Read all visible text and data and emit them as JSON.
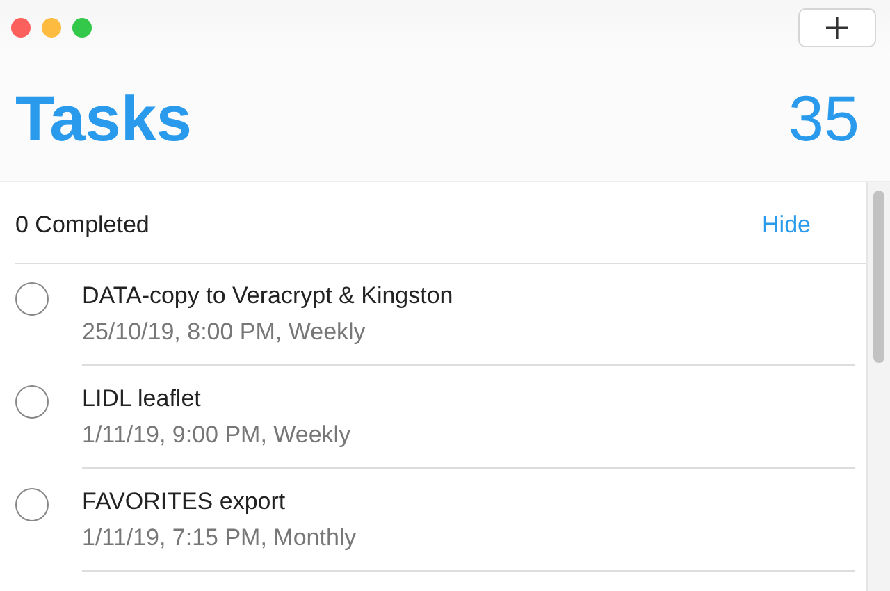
{
  "window": {
    "controls": [
      {
        "color": "#fc605c"
      },
      {
        "color": "#fdbc40"
      },
      {
        "color": "#34c84a"
      }
    ]
  },
  "header": {
    "title": "Tasks",
    "count": "35"
  },
  "completed_bar": {
    "label": "0 Completed",
    "action": "Hide"
  },
  "tasks": [
    {
      "title": "DATA-copy to Veracrypt & Kingston",
      "detail": "25/10/19, 8:00 PM, Weekly",
      "checked": false
    },
    {
      "title": "LIDL leaflet",
      "detail": "1/11/19, 9:00 PM, Weekly",
      "checked": false
    },
    {
      "title": "FAVORITES export",
      "detail": "1/11/19, 7:15 PM, Monthly",
      "checked": false
    }
  ]
}
